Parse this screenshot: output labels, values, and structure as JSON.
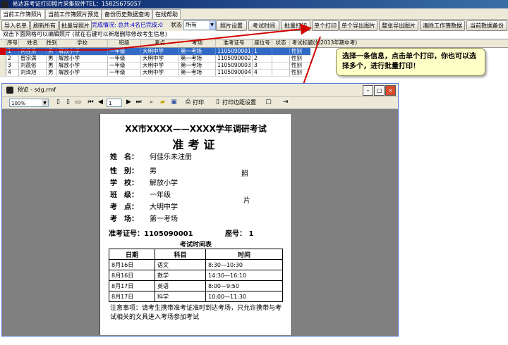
{
  "app": {
    "title": "易达准考证打印照片采集软件TEL：15825675057"
  },
  "tabs": [
    "当前工作簿照片",
    "当前工作簿照片预览",
    "备份历史数据查询",
    "在线帮助"
  ],
  "toolbar": {
    "import": "导入名单",
    "refresh": "刷新所有",
    "batch_import_photos": "批量导照片",
    "status": "完成情况: 总共:4名已完成:0",
    "filter_label": "状态",
    "filter_value": "所有",
    "photo_settings": "照片设置",
    "exam_time": "考试时间",
    "batch_print": "批量打印",
    "single_print": "单个打印",
    "single_export": "单个导出图片",
    "export_all": "整张导出图片",
    "clear_book": "清除工作簿数据",
    "backup": "当前数据备份"
  },
  "hint": "双击下面网格可以编辑照片 (就在右键可以新增删除修改考生信息)",
  "grid": {
    "columns": [
      "序号",
      "姓名",
      "性别",
      "学校",
      "班级",
      "考点",
      "考场",
      "准考证号",
      "座位号",
      "状态",
      "考试标题",
      "(如2013年期中考)"
    ],
    "rows": [
      [
        "1",
        "何佳乐",
        "男",
        "解放小学",
        "一年级",
        "大明中学",
        "第一考场",
        "1105090001",
        "1",
        "",
        "性别"
      ],
      [
        "2",
        "曾宗满",
        "男",
        "解放小学",
        "一年级",
        "大明中学",
        "第一考场",
        "1105090002",
        "2",
        "",
        "性别"
      ],
      [
        "3",
        "刘晨俗",
        "男",
        "解放小学",
        "一年级",
        "大明中学",
        "第一考场",
        "1105090003",
        "3",
        "",
        "性别"
      ],
      [
        "4",
        "刘泽旭",
        "男",
        "解放小学",
        "一年级",
        "大明中学",
        "第一考场",
        "1105090004",
        "4",
        "",
        "性别"
      ]
    ]
  },
  "callout": "选择一条信息，点击单个打印，你也可以选择多个，进行批量打印！",
  "preview": {
    "title": "预览 - sdg.rmf",
    "zoom": "100%",
    "page": "1",
    "print": "打印",
    "page_setup": "打印边距设置",
    "ticket": {
      "title": "XX市XXXX——XXXX学年调研考试",
      "subtitle": "准考证",
      "name_label": "姓　名：",
      "name_value": "何佳乐未注册",
      "gender_label": "性　别：",
      "gender_value": "男",
      "school_label": "学　校：",
      "school_value": "解放小学",
      "class_label": "班　级：",
      "class_value": "一年级",
      "site_label": "考　点：",
      "site_value": "大明中学",
      "room_label": "考　场：",
      "room_value": "第一考场",
      "photo1": "照",
      "photo2": "片",
      "ticket_no": "准考证号：1105090001",
      "seat": "座号：  1",
      "schedule_title": "考试时间表",
      "schedule_headers": [
        "日期",
        "科目",
        "时间"
      ],
      "schedule": [
        [
          "8月16日",
          "语文",
          "8:30—10:30"
        ],
        [
          "8月16日",
          "数学",
          "14:30—16:10"
        ],
        [
          "8月17日",
          "英语",
          "8:00—9:50"
        ],
        [
          "8月17日",
          "科学",
          "10:00—11:30"
        ]
      ],
      "notice": "注意事项：请考生携带准考证准时到达考场，只允许携带与考试相关的文具进入考场参加考试"
    }
  }
}
